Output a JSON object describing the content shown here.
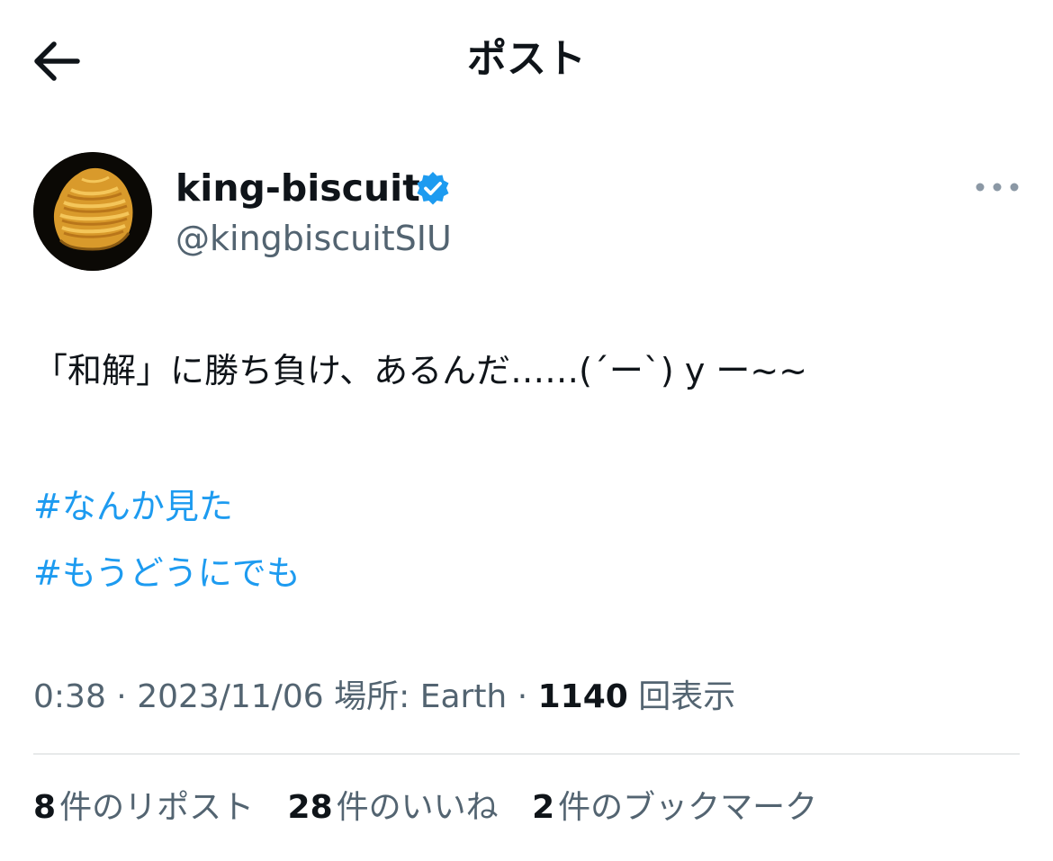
{
  "header": {
    "title": "ポスト",
    "back_icon": "arrow-left-icon"
  },
  "author": {
    "display_name": "king-biscuit",
    "handle": "@kingbiscuitSIU",
    "verified_icon": "verified-badge-icon",
    "verified_color": "#1d9bf0",
    "more_icon": "more-horizontal-icon"
  },
  "post": {
    "text": "「和解」に勝ち負け、あるんだ……(´ー`) y ー~~",
    "hashtags": [
      "#なんか見た",
      "#もうどうにでも"
    ]
  },
  "meta": {
    "time": "0:38",
    "date": "2023/11/06",
    "location_label": "場所: Earth",
    "views_count": "1140",
    "views_label": "回表示"
  },
  "stats": [
    {
      "count": "8",
      "label": "件のリポスト"
    },
    {
      "count": "28",
      "label": "件のいいね"
    },
    {
      "count": "2",
      "label": "件のブックマーク"
    }
  ],
  "colors": {
    "text": "#0f1419",
    "secondary": "#536471",
    "link": "#1d9bf0",
    "divider": "#e7e9ea"
  }
}
